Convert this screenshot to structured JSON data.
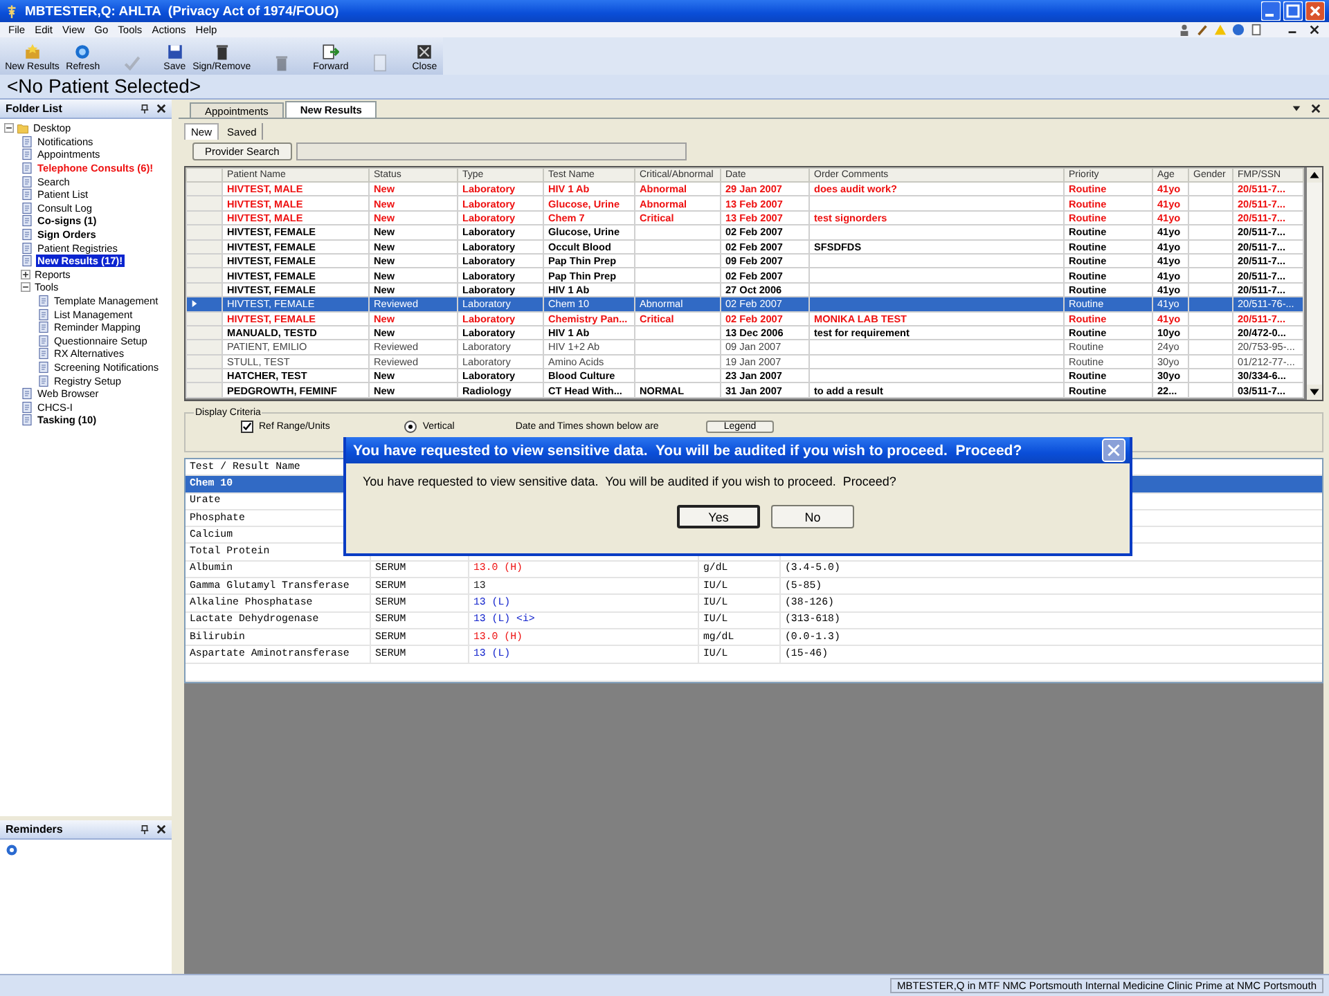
{
  "window": {
    "title": "MBTESTER,Q: AHLTA  (Privacy Act of 1974/FOUO)"
  },
  "menu": [
    "File",
    "Edit",
    "View",
    "Go",
    "Tools",
    "Actions",
    "Help"
  ],
  "toolbar": [
    {
      "label": "New Results",
      "disabled": false
    },
    {
      "label": "Refresh",
      "disabled": false
    },
    {
      "disabled": true
    },
    {
      "label": "Save",
      "disabled": false
    },
    {
      "label": "Sign/Remove",
      "disabled": false
    },
    {
      "disabled": true
    },
    {
      "label": "Forward",
      "disabled": false
    },
    {
      "disabled": true
    },
    {
      "label": "Close",
      "disabled": false
    }
  ],
  "banner": "<No Patient Selected>",
  "folder_list": {
    "title": "Folder List",
    "tree": [
      {
        "label": "Desktop",
        "kind": "folder",
        "expanded": true,
        "bold": false,
        "alert": false,
        "selected": false,
        "children": [
          {
            "label": "Notifications",
            "kind": "item",
            "bold": false,
            "alert": false,
            "selected": false
          },
          {
            "label": "Appointments",
            "kind": "item",
            "bold": false,
            "alert": false,
            "selected": false
          },
          {
            "label": "Telephone Consults (6)!",
            "kind": "item",
            "bold": true,
            "alert": true,
            "selected": false
          },
          {
            "label": "Search",
            "kind": "item",
            "bold": false,
            "alert": false,
            "selected": false
          },
          {
            "label": "Patient List",
            "kind": "item",
            "bold": false,
            "alert": false,
            "selected": false
          },
          {
            "label": "Consult Log",
            "kind": "item",
            "bold": false,
            "alert": false,
            "selected": false
          },
          {
            "label": "Co-signs (1)",
            "kind": "item",
            "bold": true,
            "alert": false,
            "selected": false
          },
          {
            "label": "Sign Orders",
            "kind": "item",
            "bold": true,
            "alert": false,
            "selected": false
          },
          {
            "label": "Patient Registries",
            "kind": "item",
            "bold": false,
            "alert": false,
            "selected": false
          },
          {
            "label": "New Results (17)!",
            "kind": "item",
            "bold": true,
            "alert": false,
            "selected": true
          },
          {
            "label": "Reports",
            "kind": "group",
            "expanded": false,
            "bold": false,
            "alert": false,
            "selected": false
          },
          {
            "label": "Tools",
            "kind": "group",
            "expanded": true,
            "bold": false,
            "alert": false,
            "selected": false,
            "children": [
              {
                "label": "Template Management",
                "kind": "item",
                "bold": false,
                "alert": false,
                "selected": false
              },
              {
                "label": "List Management",
                "kind": "item",
                "bold": false,
                "alert": false,
                "selected": false
              },
              {
                "label": "Reminder Mapping",
                "kind": "item",
                "bold": false,
                "alert": false,
                "selected": false
              },
              {
                "label": "Questionnaire Setup",
                "kind": "item",
                "bold": false,
                "alert": false,
                "selected": false
              },
              {
                "label": "RX Alternatives",
                "kind": "item",
                "bold": false,
                "alert": false,
                "selected": false
              },
              {
                "label": "Screening Notifications",
                "kind": "item",
                "bold": false,
                "alert": false,
                "selected": false
              },
              {
                "label": "Registry Setup",
                "kind": "item",
                "bold": false,
                "alert": false,
                "selected": false
              }
            ]
          },
          {
            "label": "Web Browser",
            "kind": "item",
            "bold": false,
            "alert": false,
            "selected": false
          },
          {
            "label": "CHCS-I",
            "kind": "item",
            "bold": false,
            "alert": false,
            "selected": false
          },
          {
            "label": "Tasking (10)",
            "kind": "item",
            "bold": true,
            "alert": false,
            "selected": false
          }
        ]
      }
    ]
  },
  "reminders": {
    "title": "Reminders"
  },
  "tabs": [
    {
      "label": "Appointments",
      "selected": false
    },
    {
      "label": "New Results",
      "selected": true
    }
  ],
  "subtabs": [
    {
      "label": "New",
      "selected": true
    },
    {
      "label": "Saved",
      "selected": false
    }
  ],
  "provider_search": {
    "button": "Provider Search"
  },
  "results_table": {
    "columns": [
      "Patient Name",
      "Status",
      "Type",
      "Test Name",
      "Critical/Abnormal",
      "Date",
      "Order Comments",
      "Priority",
      "Age",
      "Gender",
      "FMP/SSN"
    ],
    "rows": [
      {
        "cells": [
          "HIVTEST, MALE",
          "New",
          "Laboratory",
          "HIV 1 Ab",
          "Abnormal",
          "29 Jan 2007",
          "does audit work?",
          "Routine",
          "41yo",
          "",
          "20/511-7..."
        ],
        "unread": true,
        "flagged": true,
        "selected": false
      },
      {
        "cells": [
          "HIVTEST, MALE",
          "New",
          "Laboratory",
          "Glucose, Urine",
          "Abnormal",
          "13 Feb 2007",
          "",
          "Routine",
          "41yo",
          "",
          "20/511-7..."
        ],
        "unread": true,
        "flagged": true,
        "selected": false
      },
      {
        "cells": [
          "HIVTEST, MALE",
          "New",
          "Laboratory",
          "Chem 7",
          "Critical",
          "13 Feb 2007",
          "test signorders",
          "Routine",
          "41yo",
          "",
          "20/511-7..."
        ],
        "unread": true,
        "flagged": true,
        "selected": false
      },
      {
        "cells": [
          "HIVTEST, FEMALE",
          "New",
          "Laboratory",
          "Glucose, Urine",
          "",
          "02 Feb 2007",
          "",
          "Routine",
          "41yo",
          "",
          "20/511-7..."
        ],
        "unread": true,
        "flagged": false,
        "selected": false
      },
      {
        "cells": [
          "HIVTEST, FEMALE",
          "New",
          "Laboratory",
          "Occult Blood",
          "",
          "02 Feb 2007",
          "SFSDFDS",
          "Routine",
          "41yo",
          "",
          "20/511-7..."
        ],
        "unread": true,
        "flagged": false,
        "selected": false
      },
      {
        "cells": [
          "HIVTEST, FEMALE",
          "New",
          "Laboratory",
          "Pap Thin Prep",
          "",
          "09 Feb 2007",
          "",
          "Routine",
          "41yo",
          "",
          "20/511-7..."
        ],
        "unread": true,
        "flagged": false,
        "selected": false
      },
      {
        "cells": [
          "HIVTEST, FEMALE",
          "New",
          "Laboratory",
          "Pap Thin Prep",
          "",
          "02 Feb 2007",
          "",
          "Routine",
          "41yo",
          "",
          "20/511-7..."
        ],
        "unread": true,
        "flagged": false,
        "selected": false
      },
      {
        "cells": [
          "HIVTEST, FEMALE",
          "New",
          "Laboratory",
          "HIV 1 Ab",
          "",
          "27 Oct 2006",
          "",
          "Routine",
          "41yo",
          "",
          "20/511-7..."
        ],
        "unread": true,
        "flagged": false,
        "selected": false
      },
      {
        "cells": [
          "HIVTEST, FEMALE",
          "Reviewed",
          "Laboratory",
          "Chem 10",
          "Abnormal",
          "02 Feb 2007",
          "",
          "Routine",
          "41yo",
          "",
          "20/511-76-..."
        ],
        "unread": false,
        "flagged": false,
        "selected": true
      },
      {
        "cells": [
          "HIVTEST, FEMALE",
          "New",
          "Laboratory",
          "Chemistry Pan...",
          "Critical",
          "02 Feb 2007",
          "MONIKA LAB TEST",
          "Routine",
          "41yo",
          "",
          "20/511-7..."
        ],
        "unread": true,
        "flagged": true,
        "selected": false
      },
      {
        "cells": [
          "MANUALD, TESTD",
          "New",
          "Laboratory",
          "HIV 1 Ab",
          "",
          "13 Dec 2006",
          "test for requirement",
          "Routine",
          "10yo",
          "",
          "20/472-0..."
        ],
        "unread": true,
        "flagged": false,
        "selected": false
      },
      {
        "cells": [
          "PATIENT, EMILIO",
          "Reviewed",
          "Laboratory",
          "HIV 1+2 Ab",
          "",
          "09 Jan 2007",
          "",
          "Routine",
          "24yo",
          "",
          "20/753-95-..."
        ],
        "unread": false,
        "flagged": false,
        "selected": false
      },
      {
        "cells": [
          "STULL, TEST",
          "Reviewed",
          "Laboratory",
          "Amino Acids",
          "",
          "19 Jan 2007",
          "",
          "Routine",
          "30yo",
          "",
          "01/212-77-..."
        ],
        "unread": false,
        "flagged": false,
        "selected": false
      },
      {
        "cells": [
          "HATCHER, TEST",
          "New",
          "Laboratory",
          "Blood Culture",
          "",
          "23 Jan 2007",
          "",
          "Routine",
          "30yo",
          "",
          "30/334-6..."
        ],
        "unread": true,
        "flagged": false,
        "selected": false
      },
      {
        "cells": [
          "PEDGROWTH, FEMINF",
          "New",
          "Radiology",
          "CT Head With...",
          "NORMAL",
          "31 Jan 2007",
          " to add a result",
          "Routine",
          "22...",
          "",
          "03/511-7..."
        ],
        "unread": true,
        "flagged": false,
        "selected": false
      }
    ]
  },
  "display_criteria": {
    "title": "Display Criteria",
    "checkbox": {
      "label": "Ref Range/Units",
      "checked": true
    },
    "radio": {
      "label": "Vertical",
      "selected": true
    },
    "note": "Date and Times shown below are",
    "legend_button": "Legend"
  },
  "detail_grid": {
    "header": "Test / Result Name",
    "rows": [
      {
        "name": "Chem 10",
        "selected": true
      },
      {
        "name": "Urate",
        "selected": false
      },
      {
        "name": "Phosphate",
        "selected": false
      },
      {
        "name": "Calcium",
        "selected": false
      },
      {
        "name": "Total Protein",
        "selected": false
      },
      {
        "name": "Albumin",
        "specimen": "SERUM",
        "result": "13.0 (H)",
        "color": "#ee1111",
        "units": "g/dL",
        "range": "(3.4-5.0)",
        "selected": false
      },
      {
        "name": "Gamma Glutamyl Transferase",
        "specimen": "SERUM",
        "result": "13",
        "color": "#222222",
        "units": "IU/L",
        "range": "(5-85)",
        "selected": false
      },
      {
        "name": "Alkaline Phosphatase",
        "specimen": "SERUM",
        "result": "13 (L)",
        "color": "#1122cc",
        "units": "IU/L",
        "range": "(38-126)",
        "selected": false
      },
      {
        "name": "Lactate Dehydrogenase",
        "specimen": "SERUM",
        "result": "13 (L) <i>",
        "color": "#1122cc",
        "units": "IU/L",
        "range": "(313-618)",
        "selected": false
      },
      {
        "name": "Bilirubin",
        "specimen": "SERUM",
        "result": "13.0 (H)",
        "color": "#ee1111",
        "units": "mg/dL",
        "range": "(0.0-1.3)",
        "selected": false
      },
      {
        "name": "Aspartate Aminotransferase",
        "specimen": "SERUM",
        "result": "13 (L)",
        "color": "#1122cc",
        "units": "IU/L",
        "range": "(15-46)",
        "selected": false
      }
    ]
  },
  "dialog": {
    "title": "You have requested to view sensitive data.  You will be audited if you wish to proceed.  Proceed?",
    "message": "You have requested to view sensitive data.  You will be audited if you wish to proceed.  Proceed?",
    "buttons": [
      {
        "label": "Yes",
        "default": true
      },
      {
        "label": "No",
        "default": false
      }
    ]
  },
  "status_bar": "MBTESTER,Q in MTF NMC Portsmouth Internal Medicine Clinic Prime at NMC Portsmouth"
}
